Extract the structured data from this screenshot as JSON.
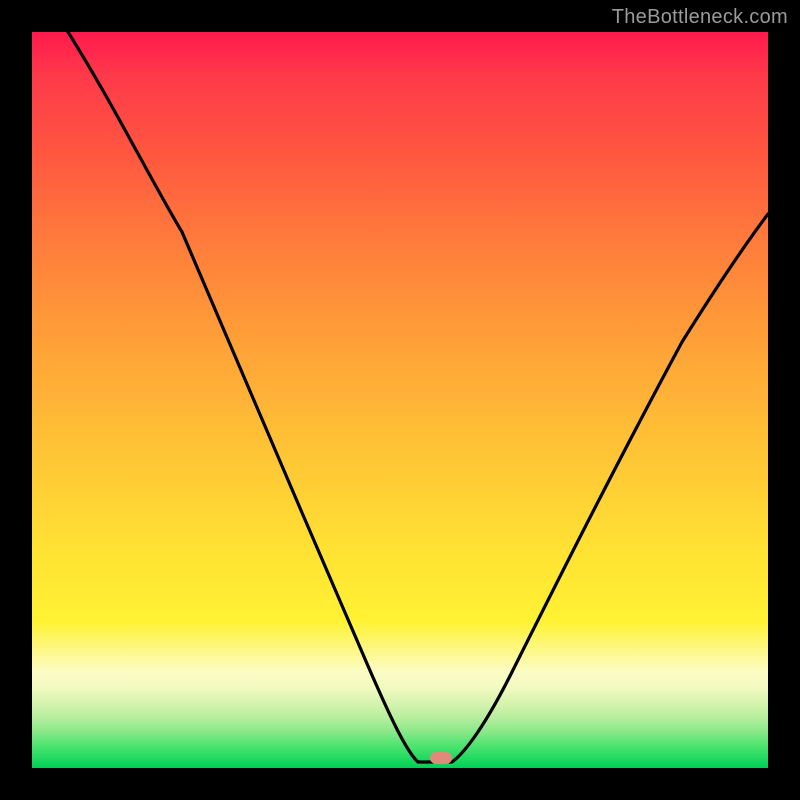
{
  "watermark": "TheBottleneck.com",
  "chart_data": {
    "type": "line",
    "title": "",
    "xlabel": "",
    "ylabel": "",
    "xlim": [
      0,
      100
    ],
    "ylim": [
      0,
      100
    ],
    "grid": false,
    "series": [
      {
        "name": "bottleneck-curve",
        "x": [
          5,
          12,
          20,
          28,
          36,
          44,
          49,
          52,
          53,
          55,
          57,
          60,
          64,
          70,
          78,
          88,
          100
        ],
        "y": [
          100,
          87,
          73,
          58,
          40,
          20,
          6,
          1,
          0,
          0,
          0.5,
          3,
          10,
          22,
          38,
          56,
          75
        ]
      }
    ],
    "marker": {
      "x": 55,
      "y": 0,
      "color": "#e08a7a"
    },
    "gradient_stops": [
      {
        "pos": 0.0,
        "color": "#ff1a4d"
      },
      {
        "pos": 0.5,
        "color": "#ffc236"
      },
      {
        "pos": 0.8,
        "color": "#fff233"
      },
      {
        "pos": 1.0,
        "color": "#00ce55"
      }
    ]
  }
}
